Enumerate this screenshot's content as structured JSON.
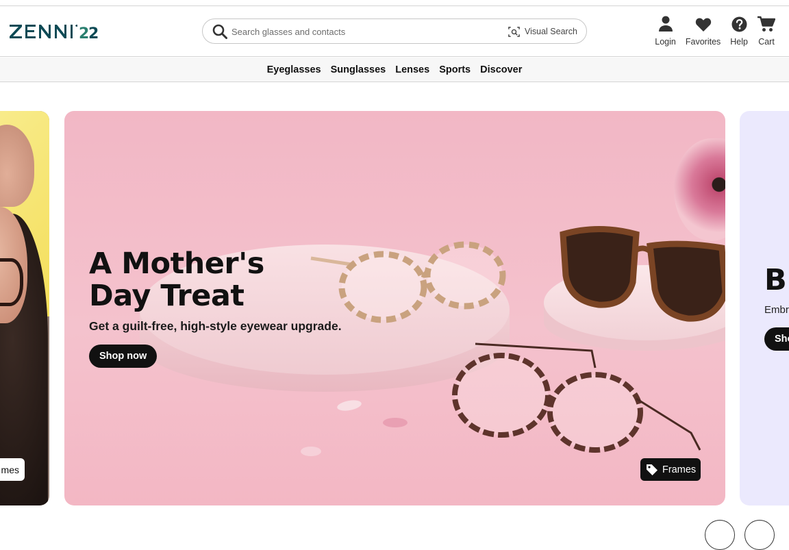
{
  "brand": {
    "logo_text": "ZENNI 22"
  },
  "search": {
    "placeholder": "Search glasses and contacts",
    "visual_search_label": "Visual Search"
  },
  "utility_nav": {
    "login": "Login",
    "favorites": "Favorites",
    "help": "Help",
    "cart": "Cart"
  },
  "main_nav": {
    "items": [
      "Eyeglasses",
      "Sunglasses",
      "Lenses",
      "Sports",
      "Discover"
    ]
  },
  "carousel": {
    "prev_slide": {
      "tag_label": "mes"
    },
    "current_slide": {
      "title_line1": "A Mother's",
      "title_line2": "Day Treat",
      "subtitle": "Get a guilt-free, high-style eyewear upgrade.",
      "cta_label": "Shop now",
      "tag_label": "Frames"
    },
    "next_slide": {
      "title": "Bl",
      "subtitle": "Embr",
      "cta_label": "Sho"
    }
  },
  "colors": {
    "hero_background": "#f3bac7",
    "next_slide_background": "#ebe9fd",
    "brand_teal": "#0d4a55",
    "cta_background": "#111111",
    "text_primary": "#111111"
  },
  "icons": {
    "search": "search-icon",
    "visual_search": "camera-scan-icon",
    "login": "person-icon",
    "favorites": "heart-icon",
    "help": "question-circle-icon",
    "cart": "cart-icon",
    "tag": "tag-icon"
  }
}
